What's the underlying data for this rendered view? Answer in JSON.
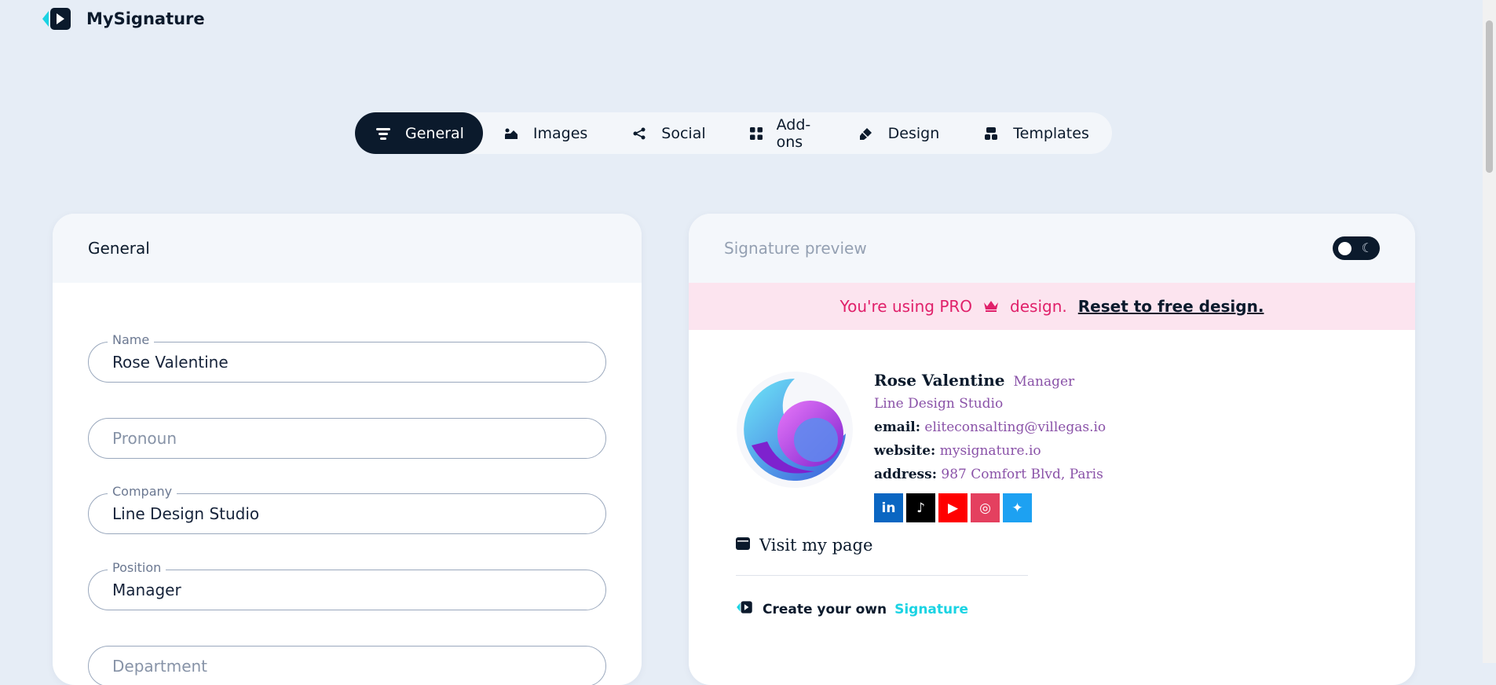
{
  "app": {
    "name": "MySignature"
  },
  "tabs": [
    {
      "label": "General",
      "icon": "lines-icon",
      "active": true
    },
    {
      "label": "Images",
      "icon": "image-icon",
      "active": false
    },
    {
      "label": "Social",
      "icon": "share-icon",
      "active": false
    },
    {
      "label": "Add-ons",
      "icon": "grid-icon",
      "active": false
    },
    {
      "label": "Design",
      "icon": "brush-icon",
      "active": false
    },
    {
      "label": "Templates",
      "icon": "templates-icon",
      "active": false
    }
  ],
  "general_panel": {
    "title": "General",
    "fields": [
      {
        "label": "Name",
        "value": "Rose Valentine",
        "placeholder": ""
      },
      {
        "label": "",
        "value": "",
        "placeholder": "Pronoun"
      },
      {
        "label": "Company",
        "value": "Line Design Studio",
        "placeholder": ""
      },
      {
        "label": "Position",
        "value": "Manager",
        "placeholder": ""
      },
      {
        "label": "",
        "value": "",
        "placeholder": "Department"
      }
    ]
  },
  "preview_panel": {
    "title": "Signature preview",
    "pro_notice": {
      "text_before": "You're using PRO",
      "text_after": "design.",
      "link": "Reset to free design."
    },
    "signature": {
      "name": "Rose Valentine",
      "position": "Manager",
      "company": "Line Design Studio",
      "email_label": "email:",
      "email": "eliteconsalting@villegas.io",
      "website_label": "website:",
      "website": "mysignature.io",
      "address_label": "address:",
      "address": "987 Comfort Blvd, Paris",
      "socials": [
        {
          "name": "linkedin-icon",
          "glyph": "in",
          "color": "#0a66c2"
        },
        {
          "name": "tiktok-icon",
          "glyph": "♪",
          "color": "#000000"
        },
        {
          "name": "youtube-icon",
          "glyph": "▶",
          "color": "#ff0000"
        },
        {
          "name": "instagram-icon",
          "glyph": "◎",
          "color": "#e4405f"
        },
        {
          "name": "twitter-icon",
          "glyph": "✦",
          "color": "#1da1f2"
        }
      ],
      "visit_text": "Visit my page",
      "create_text": "Create your own",
      "create_accent": "Signature"
    }
  },
  "colors": {
    "accent": "#1ad3e3",
    "dark": "#0b1a2c",
    "pro": "#e0206a",
    "signature_accent": "#8a52a8"
  }
}
